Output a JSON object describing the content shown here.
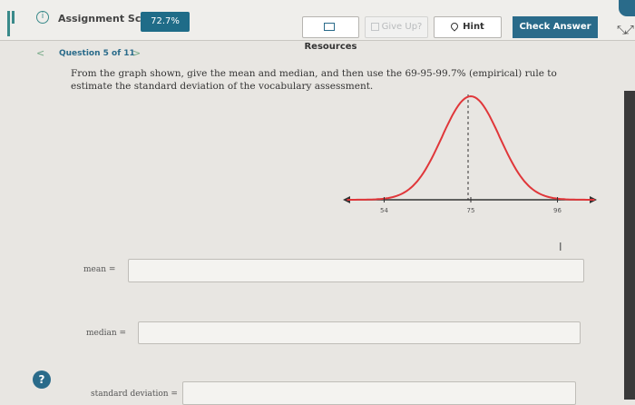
{
  "header": {
    "assignment_score_label": "Assignment Score:",
    "assignment_score_value": "72.7%",
    "resources_label": "Resources",
    "give_up_label": "Give Up?",
    "hint_label": "Hint",
    "check_answer_label": "Check Answer"
  },
  "question": {
    "number_label": "Question 5 of 11",
    "text": "From the graph shown, give the mean and median, and then use the 69-95-99.7% (empirical) rule to estimate the standard deviation of the vocabulary assessment."
  },
  "chart_data": {
    "type": "line",
    "x_ticks": [
      "54",
      "75",
      "96"
    ],
    "series": [
      {
        "curve": "normal",
        "peak_x": 75
      }
    ],
    "colors": {
      "curve": "#e0373a",
      "axis": "#333333"
    }
  },
  "form": {
    "mean_label": "mean =",
    "median_label": "median =",
    "sd_label": "standard deviation =",
    "mean_value": "",
    "median_value": "",
    "sd_value": ""
  },
  "icons": {
    "menu": "menu-icon",
    "score": "info-icon",
    "resources": "document-icon",
    "hint": "lightbulb-icon",
    "help": "help-icon",
    "expand": "expand-icon"
  }
}
